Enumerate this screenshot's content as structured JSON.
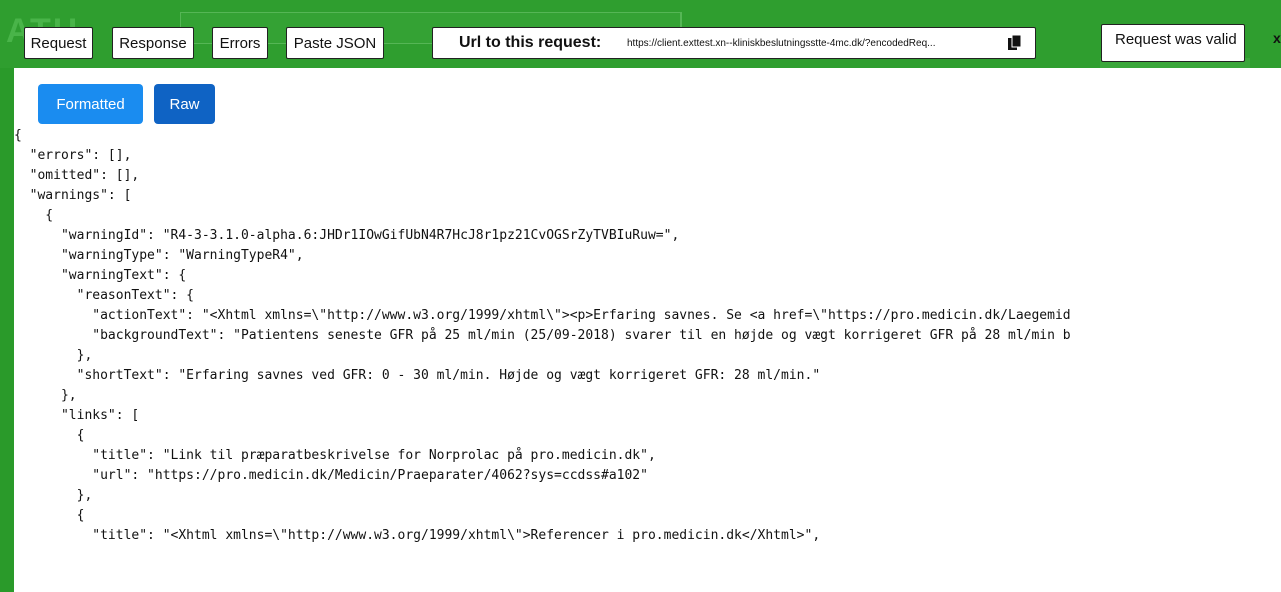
{
  "toolbar": {
    "request_label": "Request",
    "response_label": "Response",
    "errors_label": "Errors",
    "paste_json_label": "Paste JSON"
  },
  "url_panel": {
    "label": "Url to this request:",
    "value": "https://client.exttest.xn--kliniskbeslutningsstte-4mc.dk/?encodedReq..."
  },
  "status": {
    "text": "Request was valid"
  },
  "close_label": "x",
  "view_toggle": {
    "formatted_label": "Formatted",
    "raw_label": "Raw"
  },
  "json_lines": [
    "{",
    "  \"errors\": [],",
    "  \"omitted\": [],",
    "  \"warnings\": [",
    "    {",
    "      \"warningId\": \"R4-3-3.1.0-alpha.6:JHDr1IOwGifUbN4R7HcJ8r1pz21CvOGSrZyTVBIuRuw=\",",
    "      \"warningType\": \"WarningTypeR4\",",
    "      \"warningText\": {",
    "        \"reasonText\": {",
    "          \"actionText\": \"<Xhtml xmlns=\\\"http://www.w3.org/1999/xhtml\\\"><p>Erfaring savnes. Se <a href=\\\"https://pro.medicin.dk/Laegemid",
    "          \"backgroundText\": \"Patientens seneste GFR på 25 ml/min (25/09-2018) svarer til en højde og vægt korrigeret GFR på 28 ml/min b",
    "        },",
    "        \"shortText\": \"Erfaring savnes ved GFR: 0 - 30 ml/min. Højde og vægt korrigeret GFR: 28 ml/min.\"",
    "      },",
    "      \"links\": [",
    "        {",
    "          \"title\": \"Link til præparatbeskrivelse for Norprolac på pro.medicin.dk\",",
    "          \"url\": \"https://pro.medicin.dk/Medicin/Praeparater/4062?sys=ccdss#a102\"",
    "        },",
    "        {",
    "          \"title\": \"<Xhtml xmlns=\\\"http://www.w3.org/1999/xhtml\\\">Referencer i pro.medicin.dk</Xhtml>\","
  ]
}
